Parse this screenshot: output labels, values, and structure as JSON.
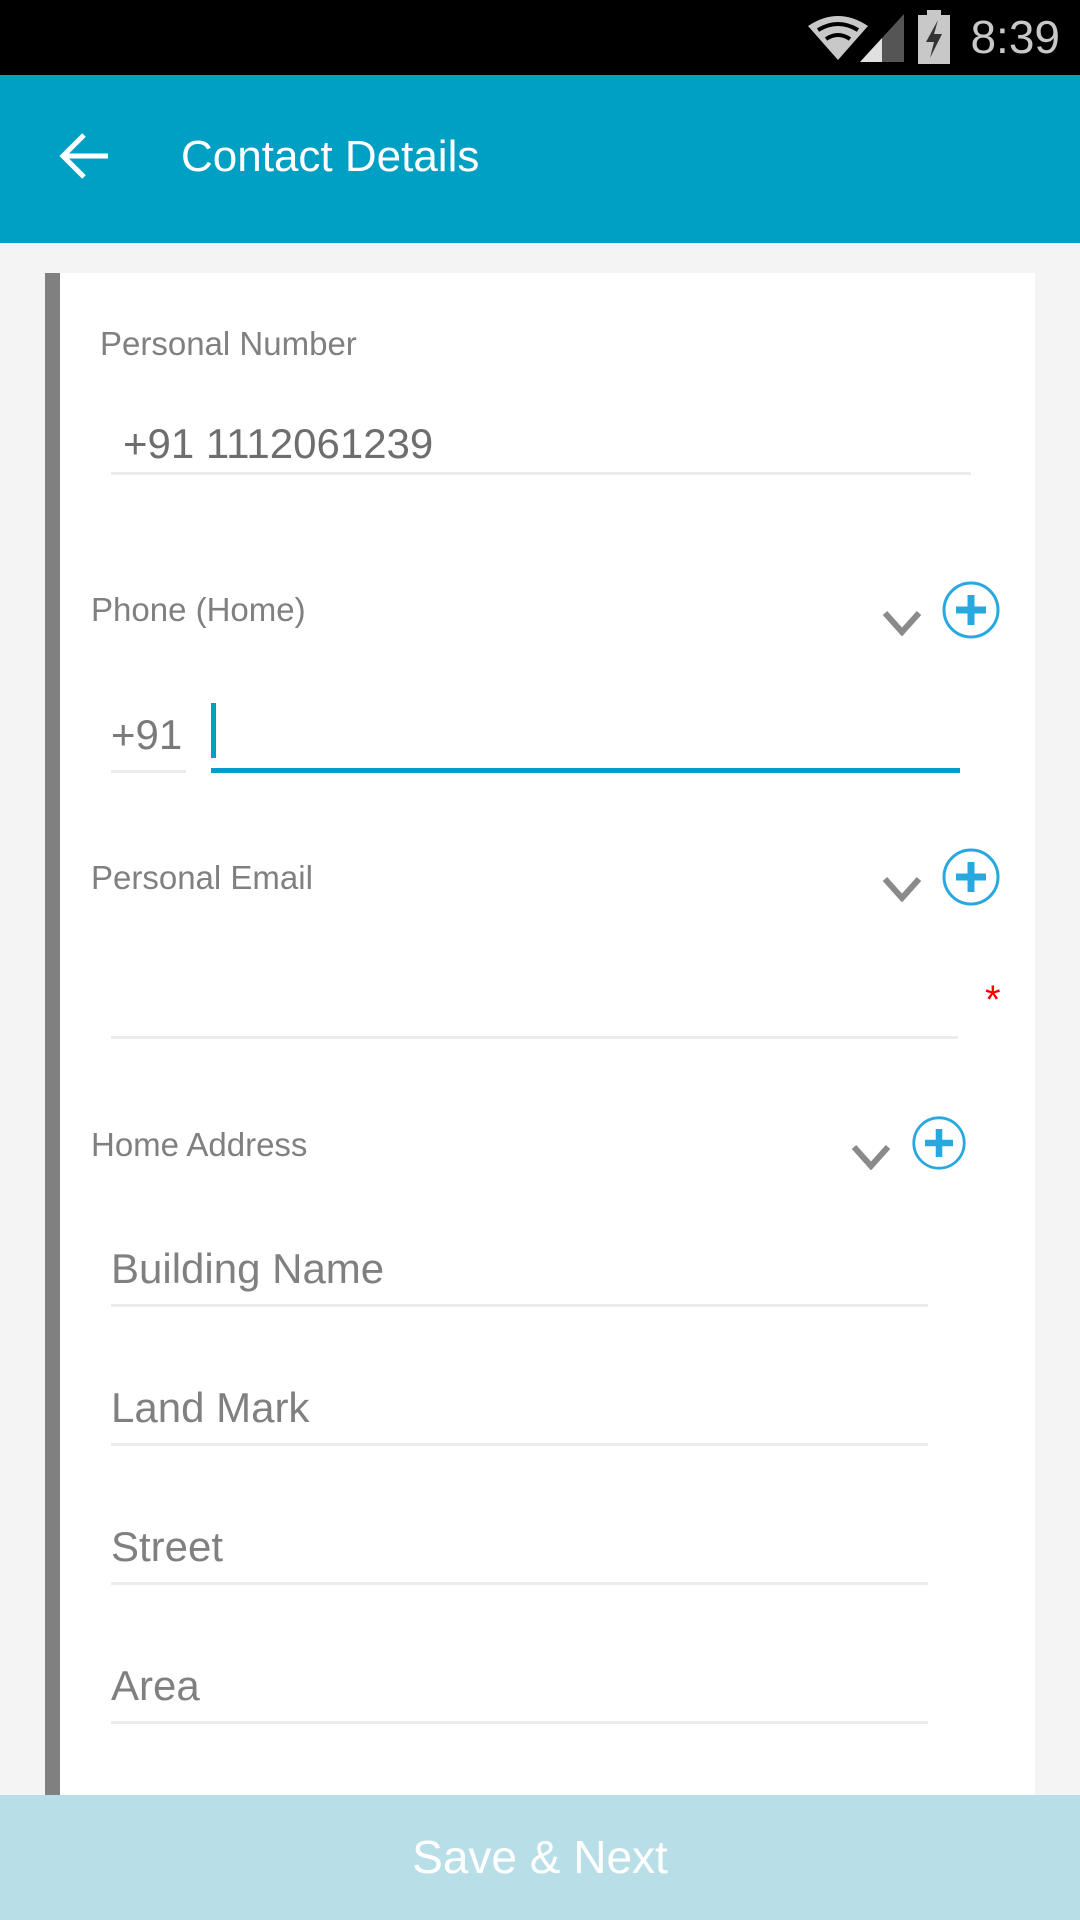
{
  "status_bar": {
    "time": "8:39",
    "icons": [
      "wifi-icon",
      "signal-icon",
      "battery-charging-icon"
    ]
  },
  "app_bar": {
    "title": "Contact Details",
    "back_icon": "arrow-left-icon"
  },
  "colors": {
    "accent": "#00a0c4",
    "plus_icon": "#29a8e0",
    "required": "#ff0000",
    "save_bar": "#b8dfe7"
  },
  "form": {
    "personal_number": {
      "label": "Personal Number",
      "value": "+91 1112061239"
    },
    "phone_home": {
      "label": "Phone (Home)",
      "country_code": "+91",
      "value": ""
    },
    "personal_email": {
      "label": "Personal Email",
      "value": "",
      "required_mark": "*"
    },
    "home_address": {
      "label": "Home Address",
      "fields": [
        {
          "placeholder": "Building Name"
        },
        {
          "placeholder": "Land Mark"
        },
        {
          "placeholder": "Street"
        },
        {
          "placeholder": "Area"
        }
      ]
    }
  },
  "footer": {
    "save_label": "Save & Next"
  }
}
